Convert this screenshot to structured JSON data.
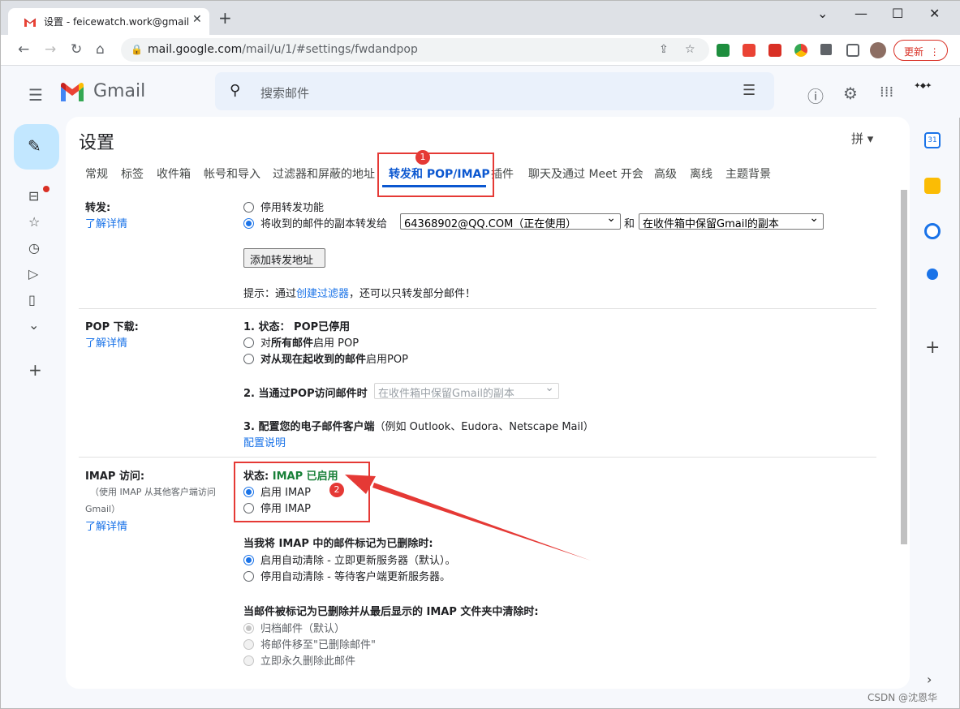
{
  "browser": {
    "tab_title": "设置 - feicewatch.work@gmail",
    "url_host": "mail.google.com",
    "url_path": "/mail/u/1/#settings/fwdandpop",
    "update_label": "更新"
  },
  "gmail": {
    "brand": "Gmail",
    "search_placeholder": "搜索邮件"
  },
  "settings": {
    "title": "设置",
    "input_tool": "拼 ▾",
    "tabs": [
      "常规",
      "标签",
      "收件箱",
      "帐号和导入",
      "过滤器和屏蔽的地址",
      "转发和 POP/IMAP",
      "插件",
      "聊天及通过 Meet 开会",
      "高级",
      "离线",
      "主题背景"
    ],
    "learn_more": "了解详情",
    "forwarding": {
      "label": "转发:",
      "disable": "停用转发功能",
      "forward_to": "将收到的邮件的副本转发给",
      "address": "64368902@QQ.COM（正在使用）",
      "and": "和",
      "keep_option": "在收件箱中保留Gmail的副本",
      "add_button": "添加转发地址",
      "tip_prefix": "提示：通过",
      "tip_link": "创建过滤器",
      "tip_suffix": "，还可以只转发部分邮件！"
    },
    "pop": {
      "label": "POP 下载:",
      "status_label": "1. 状态：",
      "status_value": "POP已停用",
      "opt_all_pre": "对",
      "opt_all_bold": "所有邮件",
      "opt_all_post": "启用 POP",
      "opt_now_bold": "对从现在起收到的邮件",
      "opt_now_post": "启用POP",
      "access_label": "2. 当通过POP访问邮件时",
      "access_select": "在收件箱中保留Gmail的副本",
      "configure_label": "3. 配置您的电子邮件客户端",
      "configure_hint": "（例如 Outlook、Eudora、Netscape Mail）",
      "configure_link": "配置说明"
    },
    "imap": {
      "label": "IMAP 访问:",
      "sub1": "（使用 IMAP 从其他客户端访问",
      "sub2": "Gmail）",
      "status_label": "状态:",
      "status_value": "IMAP 已启用",
      "enable": "启用 IMAP",
      "disable": "停用 IMAP",
      "deleted_heading": "当我将 IMAP 中的邮件标记为已删除时:",
      "auto_on": "启用自动清除 - 立即更新服务器（默认）。",
      "auto_off": "停用自动清除 - 等待客户端更新服务器。",
      "expunge_heading": "当邮件被标记为已删除并从最后显示的 IMAP 文件夹中清除时:",
      "archive": "归档邮件（默认）",
      "move_trash": "将邮件移至\"已删除邮件\"",
      "delete_forever": "立即永久删除此邮件"
    }
  },
  "annotations": {
    "badge1": "1",
    "badge2": "2"
  },
  "watermark": "CSDN @沈恩华"
}
